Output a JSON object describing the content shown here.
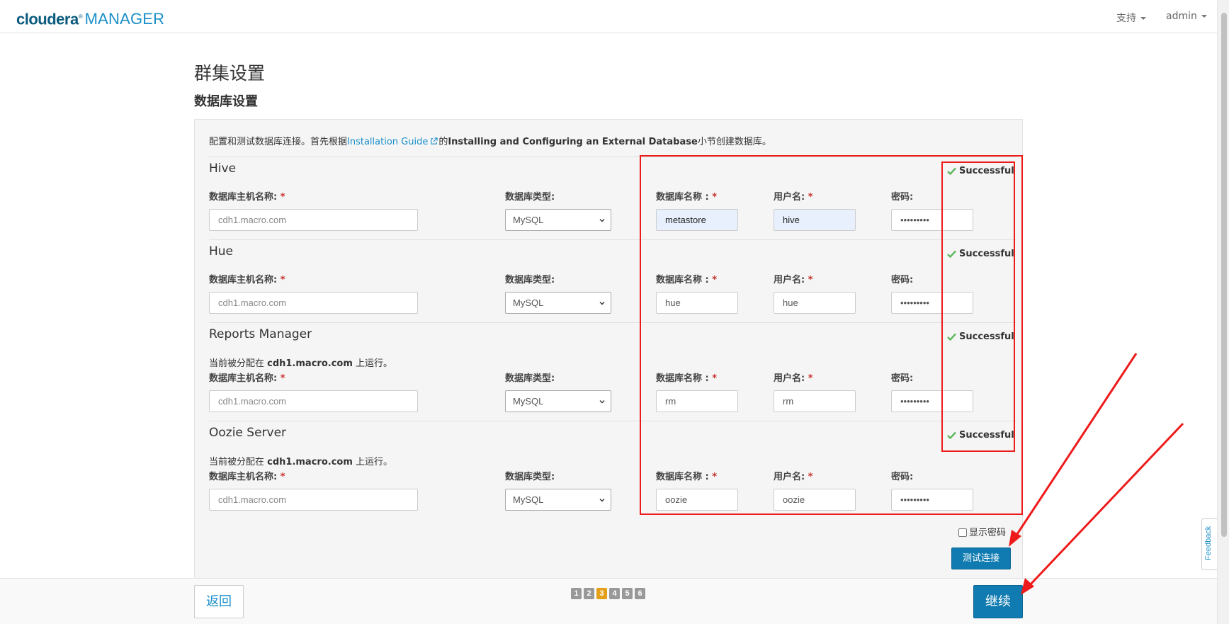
{
  "header": {
    "logo_primary": "cloudera",
    "logo_reg": "®",
    "logo_secondary": "MANAGER",
    "support_menu": "支持",
    "user_menu": "admin"
  },
  "page": {
    "title": "群集设置",
    "subtitle": "数据库设置"
  },
  "intro": {
    "prefix": "配置和测试数据库连接。首先根据",
    "link": "Installation Guide",
    "link_icon": "external-link-icon",
    "middle": "的",
    "emphasis": "Installing and Configuring an External Database",
    "suffix": "小节创建数据库。"
  },
  "labels": {
    "host": "数据库主机名称:",
    "db_type": "数据库类型:",
    "db_name": "数据库名称 :",
    "username": "用户名:",
    "password": "密码:",
    "required": "*"
  },
  "services": [
    {
      "name": "Hive",
      "runs_on_prefix": "",
      "runs_on_host": "",
      "runs_on_suffix": "",
      "host_placeholder": "cdh1.macro.com",
      "db_type": "MySQL",
      "db_name": "metastore",
      "username": "hive",
      "password": "•••••••••",
      "status": "Successful"
    },
    {
      "name": "Hue",
      "runs_on_prefix": "",
      "runs_on_host": "",
      "runs_on_suffix": "",
      "host_placeholder": "cdh1.macro.com",
      "db_type": "MySQL",
      "db_name": "hue",
      "username": "hue",
      "password": "•••••••••",
      "status": "Successful"
    },
    {
      "name": "Reports Manager",
      "runs_on_prefix": "当前被分配在 ",
      "runs_on_host": "cdh1.macro.com",
      "runs_on_suffix": " 上运行。",
      "host_placeholder": "cdh1.macro.com",
      "db_type": "MySQL",
      "db_name": "rm",
      "username": "rm",
      "password": "•••••••••",
      "status": "Successful"
    },
    {
      "name": "Oozie Server",
      "runs_on_prefix": "当前被分配在 ",
      "runs_on_host": "cdh1.macro.com",
      "runs_on_suffix": " 上运行。",
      "host_placeholder": "cdh1.macro.com",
      "db_type": "MySQL",
      "db_name": "oozie",
      "username": "oozie",
      "password": "•••••••••",
      "status": "Successful"
    }
  ],
  "controls": {
    "show_password": "显示密码",
    "test_connection": "测试连接"
  },
  "footer": {
    "back": "返回",
    "continue": "继续",
    "steps": [
      "1",
      "2",
      "3",
      "4",
      "5",
      "6"
    ],
    "current_step": 3
  },
  "feedback": "Feedback",
  "colors": {
    "brand_dark": "#0a5a7e",
    "brand_light": "#1a8fc9",
    "primary_button": "#0f7bb0",
    "success_check": "#5cb85c",
    "annotation_red": "#ee1b1b",
    "active_step": "#e5a01a"
  }
}
